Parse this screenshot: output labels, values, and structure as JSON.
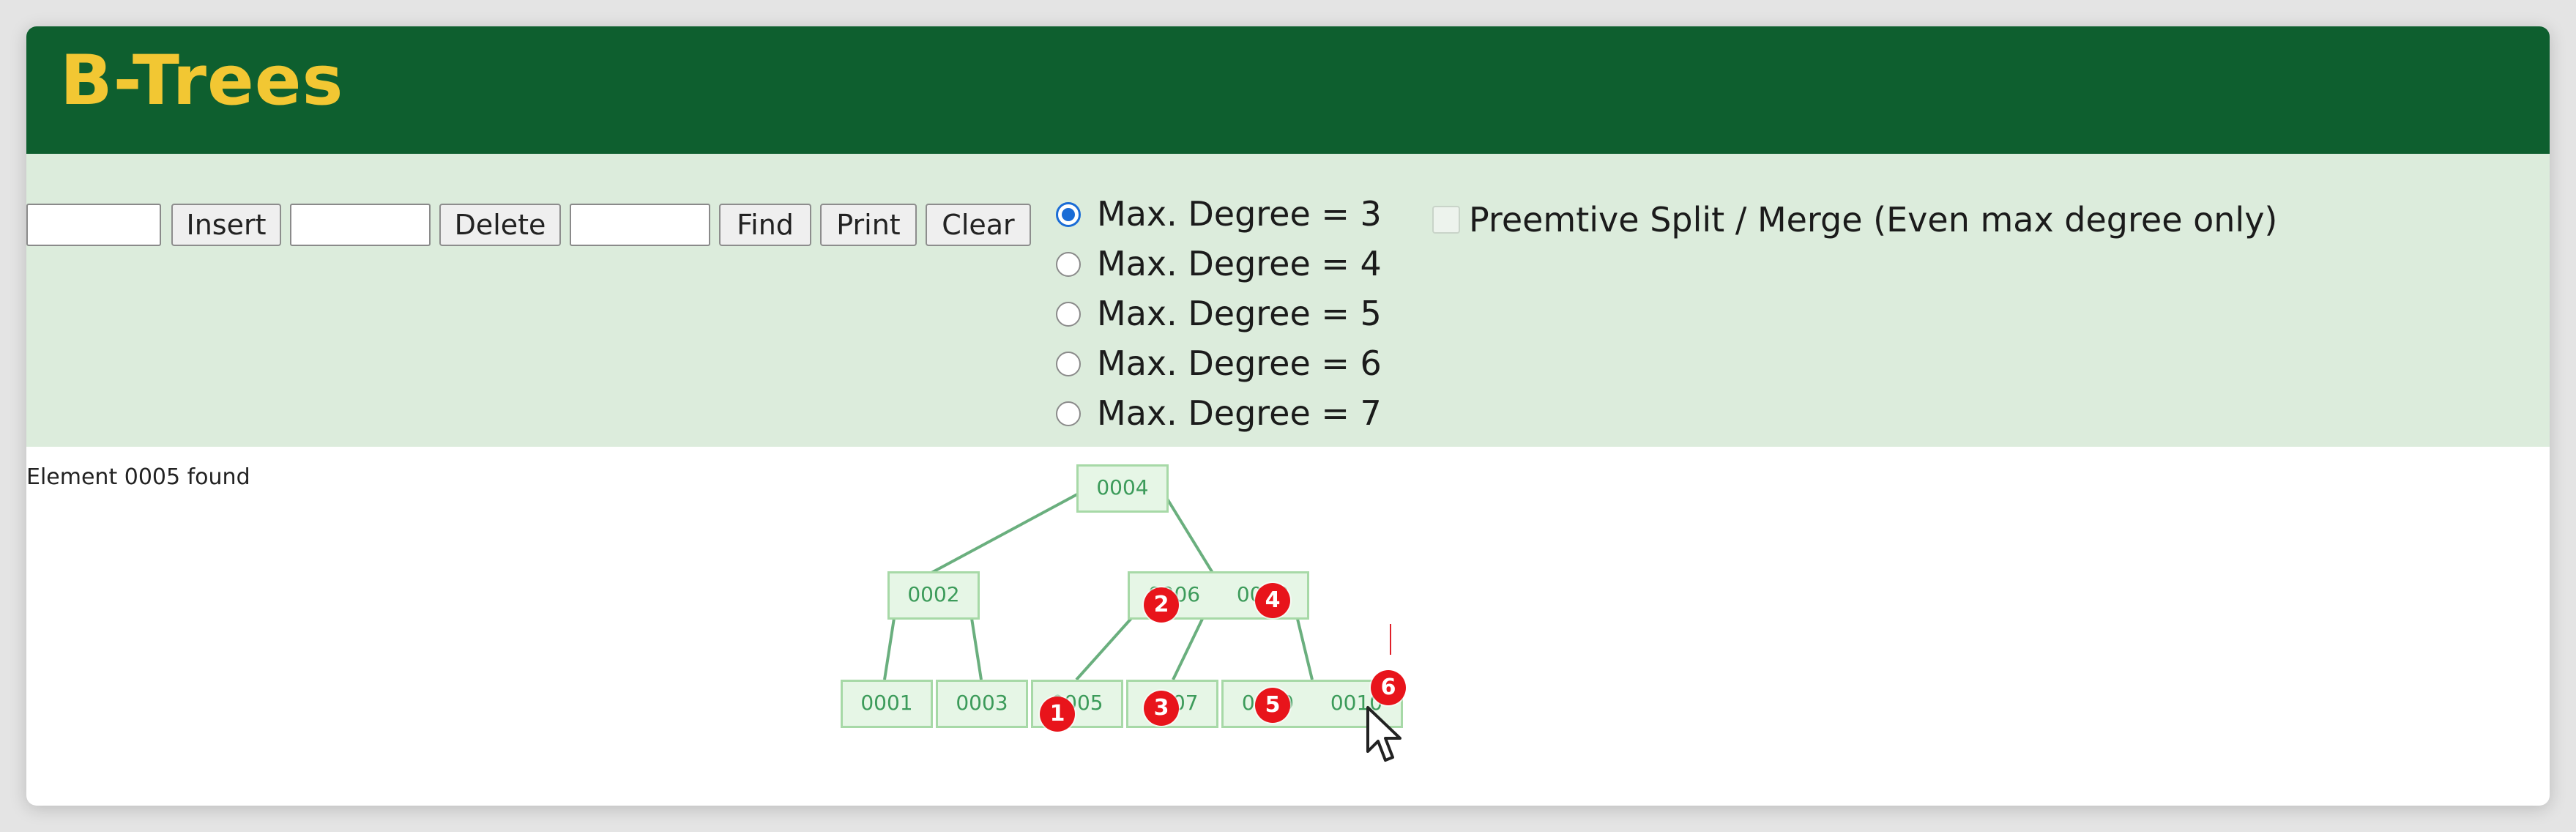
{
  "app": {
    "title": "B-Trees"
  },
  "toolbar": {
    "insert_label": "Insert",
    "delete_label": "Delete",
    "find_label": "Find",
    "print_label": "Print",
    "clear_label": "Clear",
    "insert_value": "",
    "delete_value": "",
    "find_value": ""
  },
  "degree_options": [
    {
      "label": "Max. Degree = 3",
      "checked": true
    },
    {
      "label": "Max. Degree = 4",
      "checked": false
    },
    {
      "label": "Max. Degree = 5",
      "checked": false
    },
    {
      "label": "Max. Degree = 6",
      "checked": false
    },
    {
      "label": "Max. Degree = 7",
      "checked": false
    }
  ],
  "preemptive": {
    "label": "Preemtive Split / Merge (Even max degree only)",
    "checked": false,
    "enabled": false
  },
  "status": {
    "message": "Element 0005 found"
  },
  "tree": {
    "root": {
      "keys": [
        "0004"
      ]
    },
    "level1": [
      {
        "keys": [
          "0002"
        ]
      },
      {
        "keys": [
          "0006",
          "0008"
        ]
      }
    ],
    "leaves": [
      {
        "keys": [
          "0001"
        ]
      },
      {
        "keys": [
          "0003"
        ]
      },
      {
        "keys": [
          "0005"
        ]
      },
      {
        "keys": [
          "0007"
        ]
      },
      {
        "keys": [
          "0009",
          "0010"
        ]
      }
    ]
  },
  "markers": [
    "1",
    "2",
    "3",
    "4",
    "5",
    "6"
  ],
  "colors": {
    "header_bg": "#0e5f2f",
    "title": "#f2c733",
    "controls_bg": "#dcecdc",
    "node_fill": "#e6f6e6",
    "node_border": "#a7d9a7",
    "edge": "#6aaf7e",
    "marker": "#e8141b"
  }
}
